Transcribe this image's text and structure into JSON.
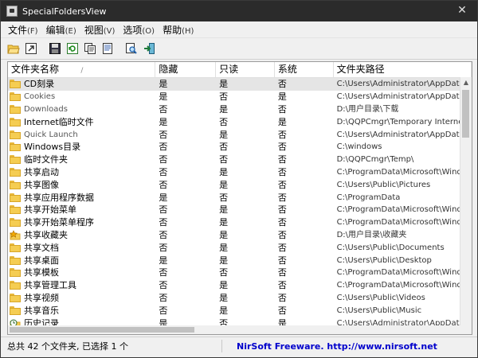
{
  "window": {
    "title": "SpecialFoldersView",
    "close_glyph": "✕"
  },
  "menu": [
    {
      "label": "文件",
      "accel": "(F)"
    },
    {
      "label": "编辑",
      "accel": "(E)"
    },
    {
      "label": "视图",
      "accel": "(V)"
    },
    {
      "label": "选项",
      "accel": "(O)"
    },
    {
      "label": "帮助",
      "accel": "(H)"
    }
  ],
  "toolbar": [
    {
      "name": "open-folder-icon"
    },
    {
      "name": "open-explorer-icon"
    },
    {
      "name": "save-icon"
    },
    {
      "name": "refresh-icon"
    },
    {
      "name": "copy-icon"
    },
    {
      "name": "html-report-icon"
    },
    {
      "name": "find-icon"
    },
    {
      "name": "exit-icon"
    }
  ],
  "columns": [
    "文件夹名称",
    "隐藏",
    "只读",
    "系统",
    "文件夹路径"
  ],
  "sort_glyph": "/",
  "rows": [
    {
      "name": "CD刻录",
      "hidden": "是",
      "readonly": "是",
      "system": "否",
      "path": "C:\\Users\\Administrator\\AppData\\Lo",
      "icon": "folder"
    },
    {
      "name": "Cookies",
      "hidden": "是",
      "readonly": "否",
      "system": "是",
      "path": "C:\\Users\\Administrator\\AppData\\Ro",
      "icon": "folder"
    },
    {
      "name": "Downloads",
      "hidden": "否",
      "readonly": "是",
      "system": "否",
      "path": "D:\\用户目录\\下载",
      "icon": "folder"
    },
    {
      "name": "Internet临时文件",
      "hidden": "是",
      "readonly": "否",
      "system": "是",
      "path": "D:\\QQPCmgr\\Temporary Internet File",
      "icon": "folder"
    },
    {
      "name": "Quick Launch",
      "hidden": "否",
      "readonly": "是",
      "system": "否",
      "path": "C:\\Users\\Administrator\\AppData\\Ro",
      "icon": "folder"
    },
    {
      "name": "Windows目录",
      "hidden": "否",
      "readonly": "否",
      "system": "否",
      "path": "C:\\windows",
      "icon": "folder"
    },
    {
      "name": "临时文件夹",
      "hidden": "否",
      "readonly": "否",
      "system": "否",
      "path": "D:\\QQPCmgr\\Temp\\",
      "icon": "folder"
    },
    {
      "name": "共享启动",
      "hidden": "否",
      "readonly": "是",
      "system": "否",
      "path": "C:\\ProgramData\\Microsoft\\Window",
      "icon": "folder"
    },
    {
      "name": "共享图像",
      "hidden": "否",
      "readonly": "是",
      "system": "否",
      "path": "C:\\Users\\Public\\Pictures",
      "icon": "folder"
    },
    {
      "name": "共享应用程序数据",
      "hidden": "是",
      "readonly": "否",
      "system": "否",
      "path": "C:\\ProgramData",
      "icon": "folder"
    },
    {
      "name": "共享开始菜单",
      "hidden": "否",
      "readonly": "是",
      "system": "否",
      "path": "C:\\ProgramData\\Microsoft\\Window",
      "icon": "folder"
    },
    {
      "name": "共享开始菜单程序",
      "hidden": "否",
      "readonly": "是",
      "system": "否",
      "path": "C:\\ProgramData\\Microsoft\\Window",
      "icon": "folder"
    },
    {
      "name": "共享收藏夹",
      "hidden": "否",
      "readonly": "是",
      "system": "否",
      "path": "D:\\用户目录\\收藏夹",
      "icon": "star"
    },
    {
      "name": "共享文档",
      "hidden": "否",
      "readonly": "是",
      "system": "否",
      "path": "C:\\Users\\Public\\Documents",
      "icon": "folder"
    },
    {
      "name": "共享桌面",
      "hidden": "是",
      "readonly": "是",
      "system": "否",
      "path": "C:\\Users\\Public\\Desktop",
      "icon": "folder"
    },
    {
      "name": "共享模板",
      "hidden": "否",
      "readonly": "否",
      "system": "否",
      "path": "C:\\ProgramData\\Microsoft\\Window",
      "icon": "folder"
    },
    {
      "name": "共享管理工具",
      "hidden": "否",
      "readonly": "是",
      "system": "否",
      "path": "C:\\ProgramData\\Microsoft\\Window",
      "icon": "folder"
    },
    {
      "name": "共享视频",
      "hidden": "否",
      "readonly": "是",
      "system": "否",
      "path": "C:\\Users\\Public\\Videos",
      "icon": "folder"
    },
    {
      "name": "共享音乐",
      "hidden": "否",
      "readonly": "是",
      "system": "否",
      "path": "C:\\Users\\Public\\Music",
      "icon": "folder"
    },
    {
      "name": "历史记录",
      "hidden": "是",
      "readonly": "否",
      "system": "是",
      "path": "C:\\Users\\Administrator\\AppData\\Lo",
      "icon": "history"
    }
  ],
  "status": {
    "left": "总共 42 个文件夹, 已选择 1 个",
    "right": "NirSoft Freeware.  http://www.nirsoft.net"
  }
}
